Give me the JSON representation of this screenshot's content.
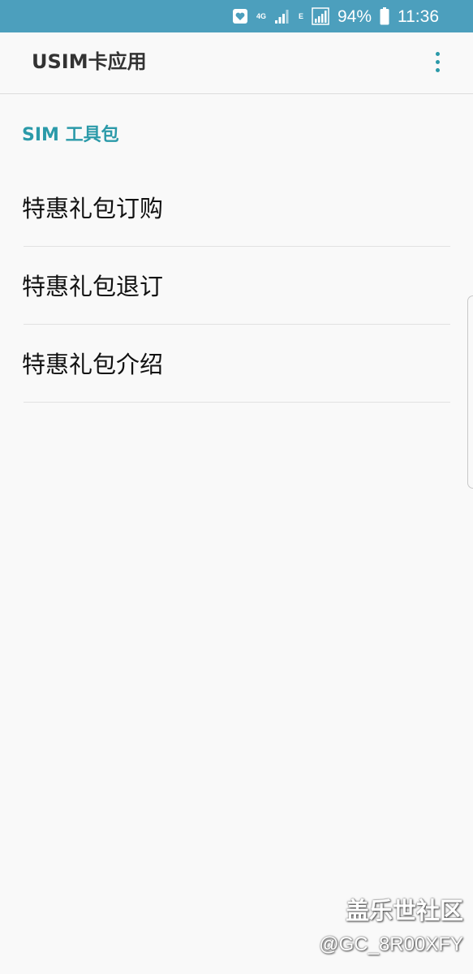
{
  "status_bar": {
    "network_label": "4G",
    "network2_label": "E",
    "battery_percent": "94%",
    "time": "11:36",
    "icons": [
      "notification-icon",
      "signal-icon",
      "signal-icon",
      "battery-icon"
    ]
  },
  "app_bar": {
    "title": "USIM卡应用",
    "menu_icon": "more-vert-icon"
  },
  "section": {
    "header": "SIM 工具包"
  },
  "menu": {
    "items": [
      {
        "label": "特惠礼包订购"
      },
      {
        "label": "特惠礼包退订"
      },
      {
        "label": "特惠礼包介绍"
      }
    ]
  },
  "watermark": {
    "logo": "盖乐世社区",
    "user": "@GC_8R00XFY"
  },
  "colors": {
    "status_bar": "#4c9fbd",
    "accent": "#2b9aa9",
    "background": "#f9f9f9"
  }
}
